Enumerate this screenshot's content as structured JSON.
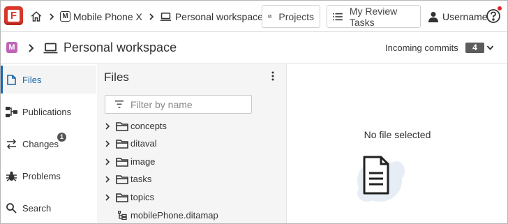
{
  "app": {
    "logo_letter": "F",
    "accent_color": "#d8362b"
  },
  "breadcrumb": {
    "home_icon": "home-icon",
    "project_badge": "M",
    "project_name": "Mobile Phone X",
    "workspace_name": "Personal workspace"
  },
  "toolbar": {
    "projects_label": "Projects",
    "review_tasks_label": "My Review Tasks",
    "username": "Username",
    "notification_dot_color": "#e0242a"
  },
  "subbar": {
    "project_badge": "M",
    "project_badge_color": "#c064b8",
    "title": "Personal workspace",
    "incoming_label": "Incoming commits",
    "incoming_count": "4"
  },
  "nav": {
    "items": [
      {
        "label": "Files",
        "icon": "files-icon",
        "active": true
      },
      {
        "label": "Publications",
        "icon": "publications-icon",
        "active": false
      },
      {
        "label": "Changes",
        "icon": "changes-icon",
        "active": false
      },
      {
        "label": "Problems",
        "icon": "bug-icon",
        "active": false
      },
      {
        "label": "Search",
        "icon": "search-icon",
        "active": false
      }
    ],
    "changes_badge": "1"
  },
  "files_panel": {
    "title": "Files",
    "filter_placeholder": "Filter by name",
    "filter_value": "",
    "tree": [
      {
        "label": "concepts",
        "type": "folder"
      },
      {
        "label": "ditaval",
        "type": "folder"
      },
      {
        "label": "image",
        "type": "folder"
      },
      {
        "label": "tasks",
        "type": "folder"
      },
      {
        "label": "topics",
        "type": "folder"
      },
      {
        "label": "mobilePhone.ditamap",
        "type": "ditamap"
      }
    ]
  },
  "preview": {
    "empty_message": "No file selected",
    "illustration": "document-icon"
  }
}
